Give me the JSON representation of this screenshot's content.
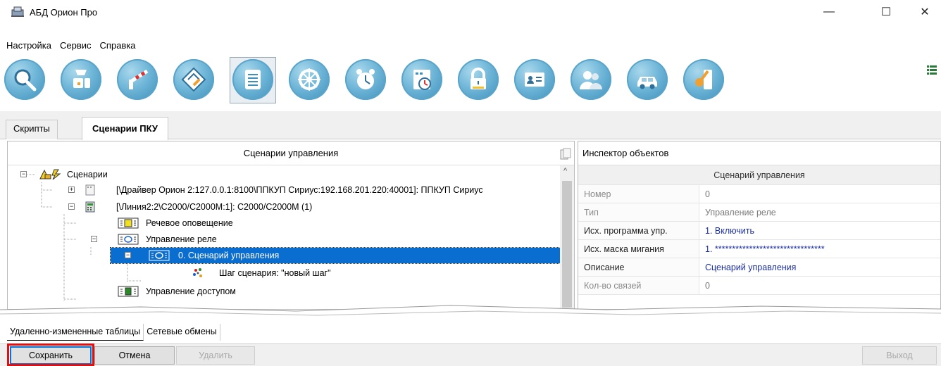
{
  "window": {
    "title": "АБД Орион Про",
    "controls": [
      "—",
      "☐",
      "✕"
    ]
  },
  "menu": [
    "Настройка",
    "Сервис",
    "Справка"
  ],
  "toolbar": {
    "buttons": [
      "search-icon",
      "device-icon",
      "barrier-icon",
      "map-icon",
      "list-icon",
      "wheel-icon",
      "alarm-clock-icon",
      "schedule-icon",
      "lock-icon",
      "id-card-icon",
      "users-icon",
      "car-icon",
      "key-icon"
    ],
    "active": "list-icon"
  },
  "tabs": [
    {
      "label": "Скрипты",
      "active": false
    },
    {
      "label": "Сценарии ПКУ",
      "active": true
    }
  ],
  "tree": {
    "header": "Сценарии управления",
    "nodes": [
      {
        "label": "Сценарии",
        "icon": "scenarios-icon"
      },
      {
        "label": "[\\Драйвер Орион 2:127.0.0.1:8100\\ППКУП Сириус:192.168.201.220:40001]: ППКУП Сириус",
        "icon": "device-icon"
      },
      {
        "label": "[\\Линия2:2\\С2000/С2000М:1]: С2000/С2000М (1)",
        "icon": "controller-icon"
      },
      {
        "label": "Речевое оповещение",
        "icon": "speech-icon"
      },
      {
        "label": "Управление реле",
        "icon": "relay-icon"
      },
      {
        "label": "0. Сценарий управления",
        "icon": "relay-icon",
        "selected": true
      },
      {
        "label": "Шаг сценария: \"новый шаг\"",
        "icon": "step-icon"
      },
      {
        "label": "Управление доступом",
        "icon": "access-icon"
      }
    ]
  },
  "inspector": {
    "header": "Инспектор объектов",
    "title": "Сценарий управления",
    "rows": [
      {
        "name": "Номер",
        "value": "0"
      },
      {
        "name": "Тип",
        "value": "Управление реле"
      },
      {
        "name": "Исх. программа упр.",
        "value": "1. Включить"
      },
      {
        "name": "Исх. маска мигания",
        "value": "1. ********************************"
      },
      {
        "name": "Описание",
        "value": "Сценарий управления"
      },
      {
        "name": "Кол-во связей",
        "value": "0"
      }
    ]
  },
  "bottom_tabs": [
    "Удаленно-измененные таблицы",
    "Сетевые обмены"
  ],
  "buttons": {
    "save": "Сохранить",
    "cancel": "Отмена",
    "delete": "Удалить",
    "exit": "Выход"
  }
}
